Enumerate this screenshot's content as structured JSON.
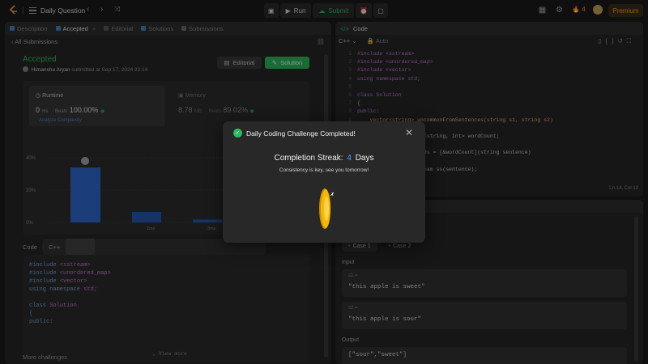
{
  "topbar": {
    "title": "Daily Question",
    "prev_icon": "‹",
    "next_icon": "›",
    "shuffle_icon": "⤨",
    "run_label": "Run",
    "submit_label": "Submit",
    "streak_count": "4",
    "premium_label": "Premium"
  },
  "left": {
    "tabs": [
      {
        "label": "Description"
      },
      {
        "label": "Accepted"
      },
      {
        "label": "Editorial"
      },
      {
        "label": "Solutions"
      },
      {
        "label": "Submissions"
      }
    ],
    "tab_close": "×",
    "back_label": "‹ All Submissions",
    "status": "Accepted",
    "author": "Himanshu Aryan",
    "submitted_text": "submitted at Sep 17, 2024 22:14",
    "editorial_btn": "Editorial",
    "solution_btn": "Solution",
    "runtime": {
      "label": "Runtime",
      "value": "0",
      "unit": "ms",
      "beats_label": "Beats",
      "beats": "100.00%",
      "link": "Analyze Complexity"
    },
    "memory": {
      "label": "Memory",
      "value": "8.78",
      "unit": "MB",
      "beats_label": "Beats",
      "beats": "89.02%"
    },
    "code_header": {
      "title": "Code",
      "lang": "C++"
    },
    "code_lines": [
      {
        "a": "#include ",
        "b": "<sstream>"
      },
      {
        "a": "#include ",
        "b": "<unordered_map>"
      },
      {
        "a": "#include ",
        "b": "<vector>"
      },
      {
        "a": "using namespace ",
        "b": "std;"
      },
      {
        "a": "",
        "b": ""
      },
      {
        "a": "class ",
        "b": "Solution"
      },
      {
        "a": "{",
        "b": ""
      },
      {
        "a": "public:",
        "b": ""
      }
    ],
    "view_more": "View more",
    "more_challenges": "More challenges"
  },
  "chart_data": {
    "type": "bar",
    "y_ticks": [
      "40%",
      "20%",
      "0%"
    ],
    "ylim": [
      0,
      40
    ],
    "categories": [
      "",
      "2ms",
      "3ms"
    ],
    "values": [
      34,
      6.5,
      1.8
    ],
    "highlight_index": 0,
    "mini_labels": [
      "2ms",
      "3ms"
    ]
  },
  "right": {
    "title": "Code",
    "lang": "C++",
    "auto_label": "Auto",
    "lines": [
      {
        "n": "1",
        "t": "#include <sstream>",
        "c": "#c678dd"
      },
      {
        "n": "2",
        "t": "#include <unordered_map>",
        "c": "#c678dd"
      },
      {
        "n": "3",
        "t": "#include <vector>",
        "c": "#c678dd"
      },
      {
        "n": "4",
        "t": "using namespace std;",
        "c": "#c678dd"
      },
      {
        "n": "5",
        "t": "",
        "c": "#ccc"
      },
      {
        "n": "6",
        "t": "class Solution",
        "c": "#c678dd"
      },
      {
        "n": "7",
        "t": "{",
        "c": "#ccc"
      },
      {
        "n": "8",
        "t": "public:",
        "c": "#c678dd"
      },
      {
        "n": "9",
        "t": "    vector<string> uncommonFromSentences(string s1, string s2)",
        "c": "#d7ba7d"
      },
      {
        "n": "10",
        "t": "    {",
        "c": "#ccc"
      },
      {
        "n": "11",
        "t": "        unordered_map<string, int> wordCount;",
        "c": "#ccc"
      },
      {
        "n": "12",
        "t": "",
        "c": "#ccc"
      },
      {
        "n": "13",
        "t": "        auto countWords = [&wordCount](string sentence)",
        "c": "#ccc"
      },
      {
        "n": "14",
        "t": "        {",
        "c": "#ccc"
      },
      {
        "n": "15",
        "t": "            stringstream ss(sentence);",
        "c": "#ccc"
      }
    ],
    "status": "Ln 14, Col 13"
  },
  "testcase": {
    "cases": [
      "Case 1",
      "Case 2"
    ],
    "input_label": "Input",
    "s1_name": "s1 =",
    "s1_value": "\"this apple is sweet\"",
    "s2_name": "s2 =",
    "s2_value": "\"this apple is sour\"",
    "output_label": "Output",
    "output_value": "[\"sour\",\"sweet\"]"
  },
  "modal": {
    "title": "Daily Coding Challenge Completed!",
    "close": "✕",
    "streak_prefix": "Completion Streak:",
    "streak_num": "4",
    "streak_suffix": "Days",
    "subtitle": "Consistency is key, see you tomorrow!"
  },
  "colors": {
    "accent_green": "#2cbb5d",
    "accent_blue": "#4a9eff",
    "premium": "#ffa116",
    "coin": "#f5b800"
  }
}
